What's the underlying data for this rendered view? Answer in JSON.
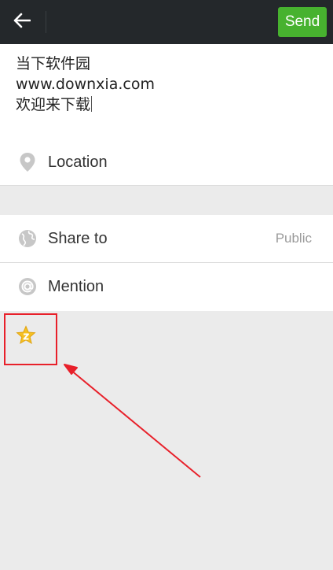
{
  "header": {
    "back_icon": "arrow-left-icon",
    "send_label": "Send",
    "send_color": "#47b22f",
    "bar_color": "#24282b"
  },
  "compose": {
    "lines": [
      "当下软件园",
      "www.downxia.com",
      "欢迎来下载"
    ]
  },
  "location": {
    "icon": "map-pin-icon",
    "label": "Location"
  },
  "options": {
    "share": {
      "icon": "globe-icon",
      "label": "Share to",
      "value": "Public"
    },
    "mention": {
      "icon": "at-icon",
      "label": "Mention"
    }
  },
  "sticker": {
    "icon": "star-emoji-icon",
    "highlight_color": "#e8202a"
  }
}
